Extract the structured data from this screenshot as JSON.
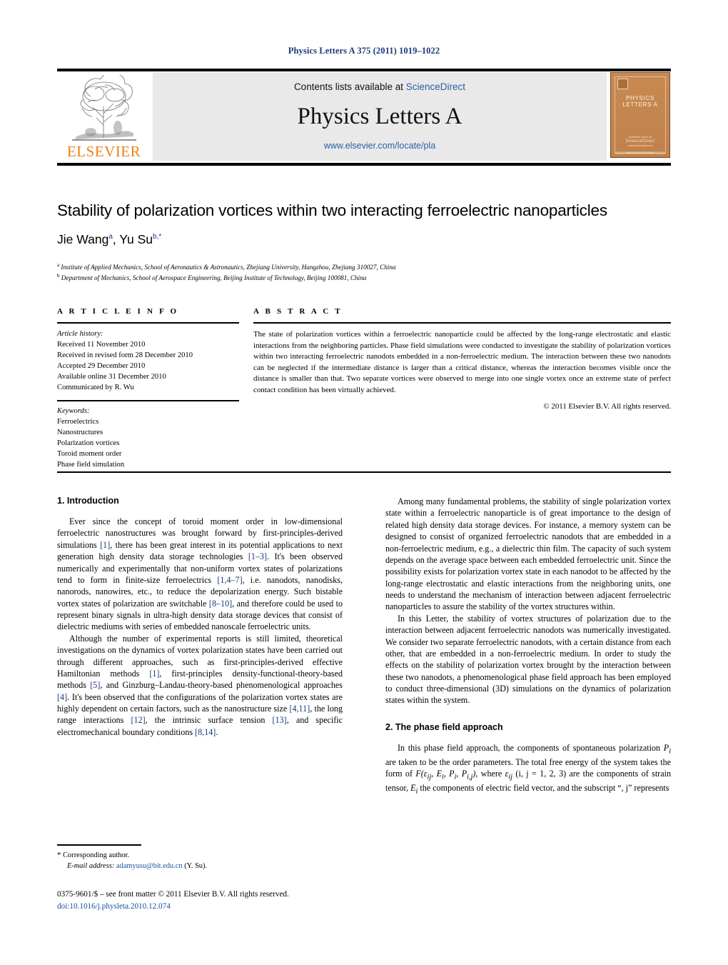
{
  "running_head": "Physics Letters A 375 (2011) 1019–1022",
  "masthead": {
    "contents_prefix": "Contents lists available at ",
    "sciencedirect": "ScienceDirect",
    "journal_title": "Physics Letters A",
    "journal_url": "www.elsevier.com/locate/pla",
    "publisher_logo_text": "ELSEVIER",
    "cover": {
      "title": "PHYSICS LETTERS A",
      "foot_line1": "Available online at",
      "foot_line2": "ScienceDirect",
      "foot_line3": "www.sciencedirect.com",
      "bottom_text": "www.elsevier.com/locate/pla"
    }
  },
  "article": {
    "title": "Stability of polarization vortices within two interacting ferroelectric nanoparticles",
    "author1": "Jie Wang",
    "author1_sup": "a",
    "author2": "Yu Su",
    "author2_sup": "b,",
    "author_star": "*",
    "affiliation_a_sup": "a",
    "affiliation_a": "Institute of Applied Mechanics, School of Aeronautics & Astronautics, Zhejiang University, Hangzhou, Zhejiang 310027, China",
    "affiliation_b_sup": "b",
    "affiliation_b": "Department of Mechanics, School of Aerospace Engineering, Beijing Institute of Technology, Beijing 100081, China"
  },
  "info": {
    "heading": "A R T I C L E   I N F O",
    "history_label": "Article history:",
    "history": [
      "Received 11 November 2010",
      "Received in revised form 28 December 2010",
      "Accepted 29 December 2010",
      "Available online 31 December 2010",
      "Communicated by R. Wu"
    ],
    "keywords_label": "Keywords:",
    "keywords": [
      "Ferroelectrics",
      "Nanostructures",
      "Polarization vortices",
      "Toroid moment order",
      "Phase field simulation"
    ]
  },
  "abstract": {
    "heading": "A B S T R A C T",
    "text": "The state of polarization vortices within a ferroelectric nanoparticle could be affected by the long-range electrostatic and elastic interactions from the neighboring particles. Phase field simulations were conducted to investigate the stability of polarization vortices within two interacting ferroelectric nanodots embedded in a non-ferroelectric medium. The interaction between these two nanodots can be neglected if the intermediate distance is larger than a critical distance, whereas the interaction becomes visible once the distance is smaller than that. Two separate vortices were observed to merge into one single vortex once an extreme state of perfect contact condition has been virtually achieved.",
    "copyright": "© 2011 Elsevier B.V. All rights reserved."
  },
  "sections": {
    "intro_heading": "1. Introduction",
    "intro_p1_a": "Ever since the concept of toroid moment order in low-dimensional ferroelectric nanostructures was brought forward by first-principles-derived simulations ",
    "intro_p1_r1": "[1]",
    "intro_p1_b": ", there has been great interest in its potential applications to next generation high density data storage technologies ",
    "intro_p1_r2": "[1–3]",
    "intro_p1_c": ". It's been observed numerically and experimentally that non-uniform vortex states of polarizations tend to form in finite-size ferroelectrics ",
    "intro_p1_r3": "[1,4–7]",
    "intro_p1_d": ", i.e. nanodots, nanodisks, nanorods, nanowires, etc., to reduce the depolarization energy. Such bistable vortex states of polarization are switchable ",
    "intro_p1_r4": "[8–10]",
    "intro_p1_e": ", and therefore could be used to represent binary signals in ultra-high density data storage devices that consist of dielectric mediums with series of embedded nanoscale ferroelectric units.",
    "intro_p2_a": "Although the number of experimental reports is still limited, theoretical investigations on the dynamics of vortex polarization states have been carried out through different approaches, such as first-principles-derived effective Hamiltonian methods ",
    "intro_p2_r1": "[1]",
    "intro_p2_b": ", first-principles density-functional-theory-based methods ",
    "intro_p2_r2": "[5]",
    "intro_p2_c": ", and Ginzburg–Landau-theory-based phenomenological approaches ",
    "intro_p2_r3": "[4]",
    "intro_p2_d": ". It's been observed that the configurations of the polarization vortex states are highly dependent on certain factors, such as the nanostructure size ",
    "intro_p2_r4": "[4,11]",
    "intro_p2_e": ", the long range interactions ",
    "intro_p2_r5": "[12]",
    "intro_p2_f": ", the intrinsic surface tension ",
    "intro_p2_r6": "[13]",
    "intro_p2_g": ", and specific electromechanical boundary conditions ",
    "intro_p2_r7": "[8,14]",
    "intro_p2_h": ".",
    "right_p1": "Among many fundamental problems, the stability of single polarization vortex state within a ferroelectric nanoparticle is of great importance to the design of related high density data storage devices. For instance, a memory system can be designed to consist of organized ferroelectric nanodots that are embedded in a non-ferroelectric medium, e.g., a dielectric thin film. The capacity of such system depends on the average space between each embedded ferroelectric unit. Since the possibility exists for polarization vortex state in each nanodot to be affected by the long-range electrostatic and elastic interactions from the neighboring units, one needs to understand the mechanism of interaction between adjacent ferroelectric nanoparticles to assure the stability of the vortex structures within.",
    "right_p2": "In this Letter, the stability of vortex structures of polarization due to the interaction between adjacent ferroelectric nanodots was numerically investigated. We consider two separate ferroelectric nanodots, with a certain distance from each other, that are embedded in a non-ferroelectric medium. In order to study the effects on the stability of polarization vortex brought by the interaction between these two nanodots, a phenomenological phase field approach has been employed to conduct three-dimensional (3D) simulations on the dynamics of polarization states within the system.",
    "phase_heading": "2. The phase field approach",
    "phase_p1_a": "In this phase field approach, the components of spontaneous polarization ",
    "phase_p1_m1": "P",
    "phase_p1_m1sub": "i",
    "phase_p1_b": " are taken to be the order parameters. The total free energy of the system takes the form of ",
    "phase_p1_m2": "F",
    "phase_p1_m3": "(ε",
    "phase_p1_m3sub": "ij",
    "phase_p1_m4": ", E",
    "phase_p1_m4sub": "i",
    "phase_p1_m5": ", P",
    "phase_p1_m5sub": "i",
    "phase_p1_m6": ", P",
    "phase_p1_m6sub": "i,j",
    "phase_p1_m7": ")",
    "phase_p1_c": ", where ",
    "phase_p1_m8": "ε",
    "phase_p1_m8sub": "ij",
    "phase_p1_d": " (i, j = 1, 2, 3) are the components of strain tensor, ",
    "phase_p1_m9": "E",
    "phase_p1_m9sub": "i",
    "phase_p1_e": " the components of electric field vector, and the subscript “, j” represents"
  },
  "footnote": {
    "star": "*",
    "corresponding": "Corresponding author.",
    "email_label": "E-mail address:",
    "email": "adamyusu@bit.edu.cn",
    "email_suffix": "(Y. Su)."
  },
  "imprint": {
    "line1": "0375-9601/$ – see front matter  © 2011 Elsevier B.V. All rights reserved.",
    "doi": "doi:10.1016/j.physleta.2010.12.074"
  },
  "colors": {
    "link": "#1a4f9c",
    "reference": "#1a3a7a",
    "elsevier_orange": "#f07f1a",
    "masthead_gray": "#e9e9e9",
    "sciencedirect_blue": "#2b5fa8"
  }
}
